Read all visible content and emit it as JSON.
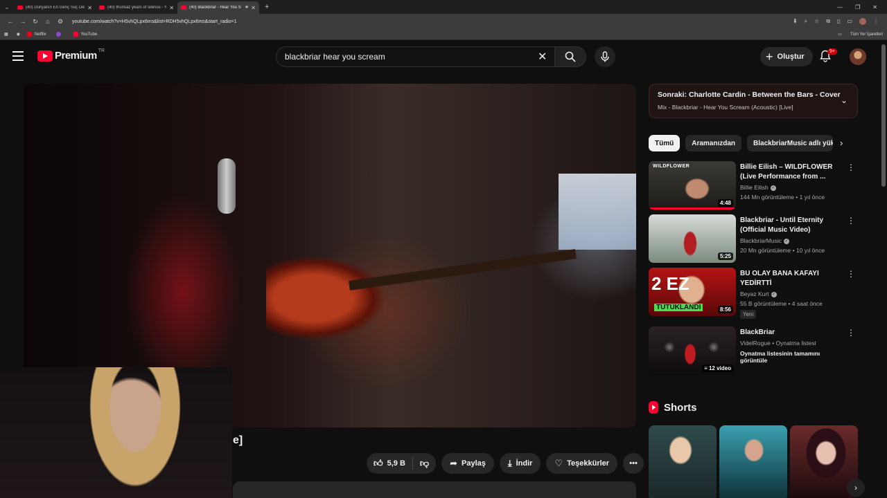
{
  "browser": {
    "tabs": [
      {
        "title": "(40) Dünyanın En Genç Suç Del",
        "active": false
      },
      {
        "title": "(40) thurisaz years of silence - Y",
        "active": false
      },
      {
        "title": "(40) Blackbriar - Hear You S",
        "active": true
      }
    ],
    "url": "youtube.com/watch?v=H5vhQLpx6ms&list=RDH5vhQLpx6ms&start_radio=1",
    "bookmarks": [
      "Netflix",
      "YouTube"
    ],
    "bookmarks_right": "Tüm Yer İşaretleri"
  },
  "header": {
    "logo_word": "Premium",
    "country": "TR",
    "search_value": "blackbriar hear you scream",
    "create_label": "Oluştur",
    "notification_badge": "9+"
  },
  "video": {
    "title_fragment": "e]"
  },
  "actions": {
    "likes": "5,9 B",
    "share": "Paylaş",
    "download": "İndir",
    "thanks": "Teşekkürler"
  },
  "up_next": {
    "label": "Sonraki:",
    "title": "Charlotte Cardin - Between the Bars - Cover",
    "subtitle": "Mix - Blackbriar - Hear You Scream (Acoustic) [Live]"
  },
  "chips": [
    "Tümü",
    "Aramanızdan",
    "BlackbriarMusic adlı yük"
  ],
  "recommendations": [
    {
      "title": "Billie Eilish – WILDFLOWER (Live Performance from ...",
      "channel": "Billie Eilish",
      "verified": true,
      "meta": "144 Mn görüntüleme • 1 yıl önce",
      "duration": "4:48",
      "thumb_text": "WILDFLOWER"
    },
    {
      "title": "Blackbriar - Until Eternity (Official Music Video)",
      "channel": "BlackbriarMusic",
      "verified": true,
      "meta": "20 Mn görüntüleme • 10 yıl önce",
      "duration": "5:25"
    },
    {
      "title": "BU OLAY BANA KAFAYI YEDİRTTİ",
      "channel": "Beyaz Kurt",
      "verified": true,
      "meta": "55 B görüntüleme • 4 saat önce",
      "duration": "8:56",
      "badge": "Yeni",
      "thumb_text": "TUTUKLANDI",
      "thumb_big": "2 EZ"
    },
    {
      "title": "BlackBriar",
      "channel": "VidelRogue • Oynatma listesi",
      "playlist_link": "Oynatma listesinin tamamını görüntüle",
      "duration": "12 video"
    }
  ],
  "shorts": {
    "heading": "Shorts"
  },
  "colors": {
    "brand_red": "#ff0033",
    "background": "#0f0f0f",
    "surface": "#272727"
  }
}
